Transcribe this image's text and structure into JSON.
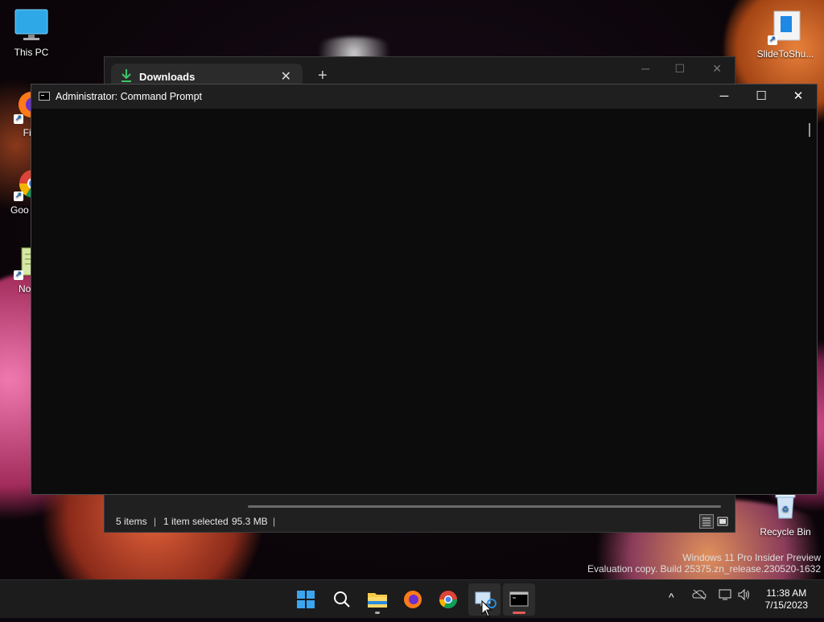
{
  "desktop": {
    "icons": [
      {
        "label": "This PC"
      },
      {
        "label": "Fire"
      },
      {
        "label": "Goo Chro"
      },
      {
        "label": "Notep"
      },
      {
        "label": "SlideToShu..."
      },
      {
        "label": "Recycle Bin"
      }
    ]
  },
  "explorer": {
    "tab_label": "Downloads",
    "tab_close": "✕",
    "new_tab": "+",
    "status": {
      "items": "5 items",
      "selected": "1 item selected",
      "size": "95.3 MB",
      "sep": "|"
    }
  },
  "cmd": {
    "title": "Administrator:  Command Prompt",
    "minimize": "─",
    "maximize": "☐",
    "close": "✕"
  },
  "watermark": {
    "line1": "Windows 11 Pro Insider Preview",
    "line2": "Evaluation copy. Build 25375.zn_release.230520-1632"
  },
  "taskbar": {
    "apps": [
      "start-icon",
      "search-icon",
      "file-explorer-icon",
      "firefox-icon",
      "chrome-icon",
      "remote-desktop-icon",
      "terminal-icon"
    ],
    "clock": {
      "time": "11:38 AM",
      "date": "7/15/2023"
    },
    "tray": {
      "overflow": "^"
    }
  },
  "colors": {
    "accent": "#0078d4",
    "terminal_bg": "#0c0c0c",
    "taskbar_bg": "#1c1c1c"
  }
}
